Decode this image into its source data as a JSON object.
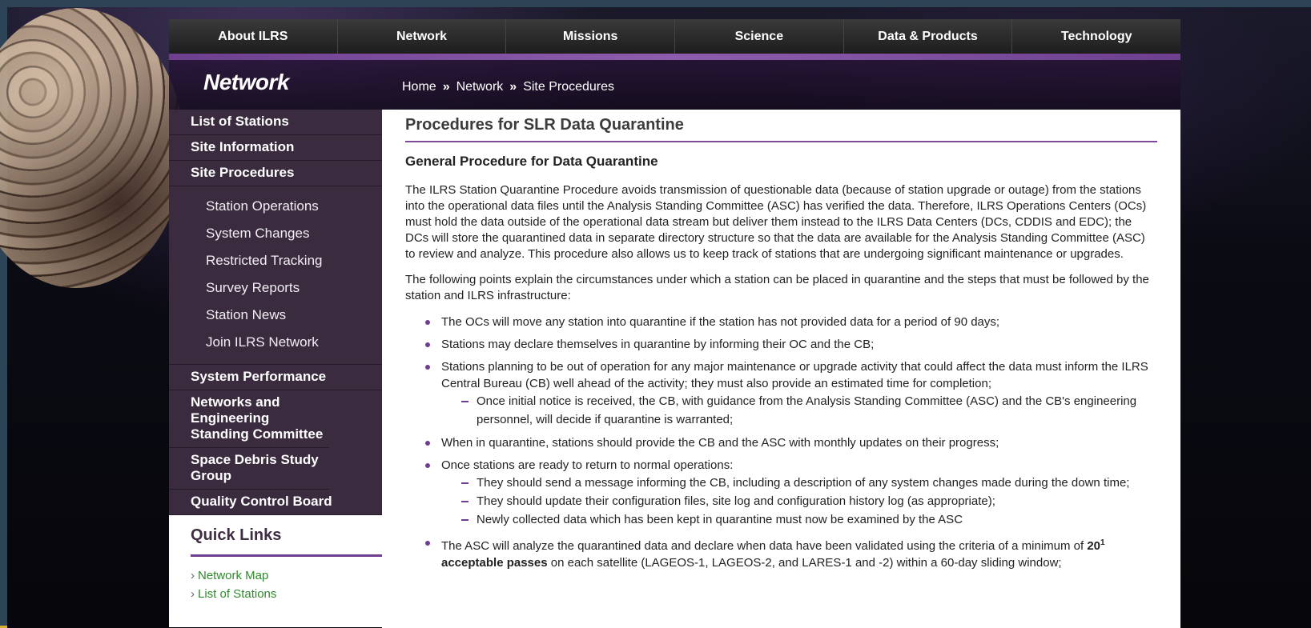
{
  "topnav": [
    "About ILRS",
    "Network",
    "Missions",
    "Science",
    "Data & Products",
    "Technology"
  ],
  "banner": {
    "section_title": "Network",
    "breadcrumb": [
      "Home",
      "Network",
      "Site Procedures"
    ],
    "separator": "»"
  },
  "sidebar": {
    "top_items": [
      "List of Stations",
      "Site Information",
      "Site Procedures"
    ],
    "sub_items": [
      "Station Operations",
      "System Changes",
      "Restricted Tracking",
      "Survey Reports",
      "Station News",
      "Join ILRS Network"
    ],
    "bottom_items": [
      "System Performance",
      "Networks and Engineering Standing Committee",
      "Space Debris Study Group",
      "Quality Control Board"
    ]
  },
  "quick_links": {
    "title": "Quick Links",
    "links": [
      "Network Map",
      "List of Stations"
    ]
  },
  "content": {
    "title": "Procedures for SLR Data Quarantine",
    "subtitle": "General Procedure for Data Quarantine",
    "para1": "The ILRS Station Quarantine Procedure avoids transmission of questionable data (because of station upgrade or outage) from the stations into the operational data files until the Analysis Standing Committee (ASC) has verified the data. Therefore, ILRS Operations Centers (OCs) must hold the data outside of the operational data stream but deliver them instead to the ILRS Data Centers (DCs, CDDIS and EDC); the DCs will store the quarantined data in separate directory structure so that the data are available for the Analysis Standing Committee (ASC) to review and analyze. This procedure also allows us to keep track of stations that are undergoing significant maintenance or upgrades.",
    "para2": "The following points explain the circumstances under which a station can be placed in quarantine and the steps that must be followed by the station and ILRS infrastructure:",
    "bullet1": "The OCs will move any station into quarantine if the station has not provided data for a period of 90 days;",
    "bullet2": "Stations may declare themselves in quarantine by informing their OC and the CB;",
    "bullet3": "Stations planning to be out of operation for any major maintenance or upgrade activity that could affect the data must inform the ILRS Central Bureau (CB) well ahead of the activity; they must also provide an estimated time for completion;",
    "bullet3_sub1": "Once initial notice is received, the CB, with guidance from the Analysis Standing Committee (ASC) and the CB's engineering personnel, will decide if quarantine is warranted;",
    "bullet4": "When in quarantine, stations should provide the CB and the ASC with monthly updates on their progress;",
    "bullet5": "Once stations are ready to return to normal operations:",
    "bullet5_sub1": "They should send a message informing the CB, including a description of any system changes made during the down time;",
    "bullet5_sub2": "They should update their configuration files, site log and configuration history log (as appropriate);",
    "bullet5_sub3": "Newly collected data which has been kept in quarantine must now be examined by the ASC",
    "bullet6_pre": "The ASC will analyze the quarantined data and declare when data have been validated using the criteria of a minimum of ",
    "bullet6_bold": "20",
    "bullet6_sup": "1",
    "bullet6_bold2": "acceptable passes",
    "bullet6_post": " on each satellite (LAGEOS-1, LAGEOS-2, and LARES-1 and -2) within a 60-day sliding window;"
  }
}
